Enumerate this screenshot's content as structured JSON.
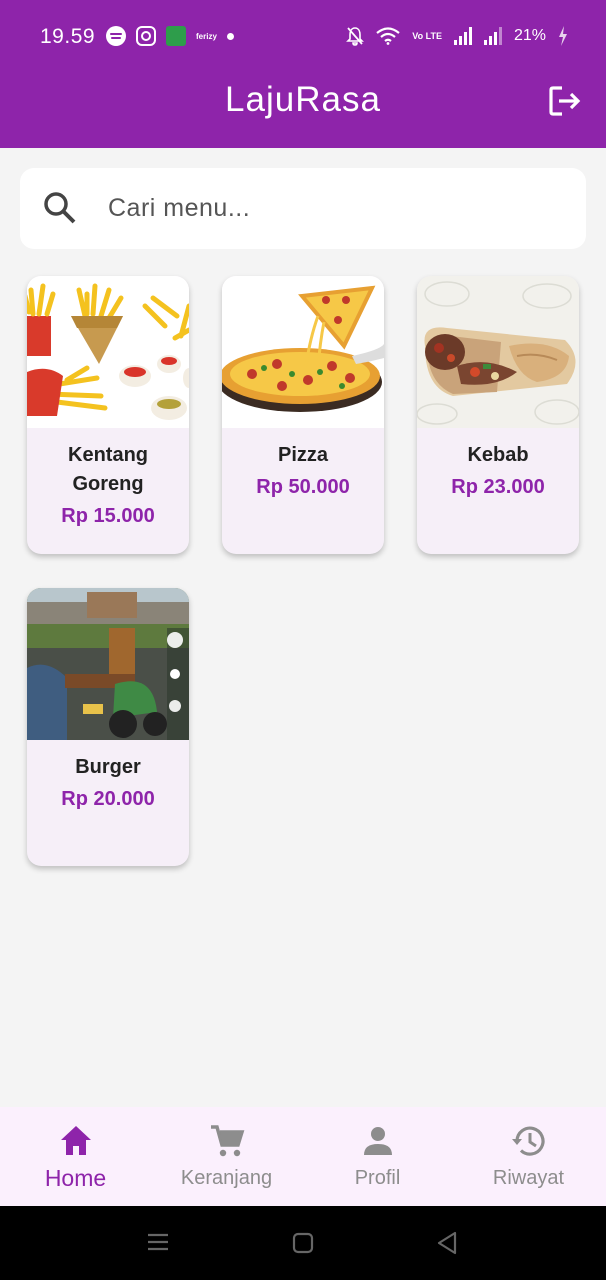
{
  "status_bar": {
    "time": "19.59",
    "battery": "21%",
    "notif_text": "ferizy",
    "volte_label": "Vo LTE"
  },
  "app": {
    "title": "LajuRasa"
  },
  "search": {
    "placeholder": "Cari menu..."
  },
  "menu": [
    {
      "name": "Kentang Goreng",
      "price": "Rp 15.000"
    },
    {
      "name": "Pizza",
      "price": "Rp 50.000"
    },
    {
      "name": "Kebab",
      "price": "Rp 23.000"
    },
    {
      "name": "Burger",
      "price": "Rp 20.000"
    }
  ],
  "nav": [
    {
      "label": "Home",
      "icon": "home-icon",
      "active": true
    },
    {
      "label": "Keranjang",
      "icon": "cart-icon",
      "active": false
    },
    {
      "label": "Profil",
      "icon": "person-icon",
      "active": false
    },
    {
      "label": "Riwayat",
      "icon": "history-icon",
      "active": false
    }
  ],
  "colors": {
    "primary": "#8e24aa",
    "card_bg": "#f6eff8",
    "nav_bg": "#fbf0fd",
    "page_bg": "#f4f4f4"
  }
}
